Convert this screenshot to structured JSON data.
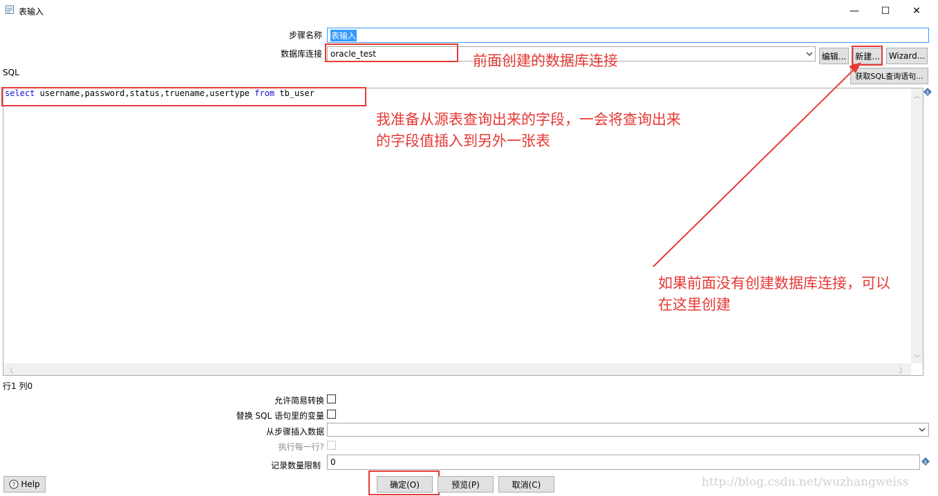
{
  "window": {
    "title": "表输入",
    "minimize_glyph": "—",
    "maximize_glyph": "☐",
    "close_glyph": "✕"
  },
  "form": {
    "step_name_label": "步骤名称",
    "step_name_value": "表输入",
    "db_conn_label": "数据库连接",
    "db_conn_value": "oracle_test",
    "edit_button": "编辑...",
    "new_button": "新建...",
    "wizard_button": "Wizard...",
    "sql_label": "SQL",
    "get_sql_button": "获取SQL查询语句..."
  },
  "sql": {
    "tokens": [
      {
        "text": "select",
        "kw": true
      },
      {
        "text": " username,password,status,truename,usertype ",
        "kw": false
      },
      {
        "text": "from",
        "kw": true
      },
      {
        "text": " tb_user",
        "kw": false
      }
    ],
    "status": "行1 列0"
  },
  "options": {
    "lazy_conversion_label": "允许简易转换",
    "replace_vars_label": "替换 SQL 语句里的变量",
    "insert_from_step_label": "从步骤插入数据",
    "execute_each_row_label": "执行每一行?",
    "limit_label": "记录数量限制",
    "limit_value": "0"
  },
  "footer": {
    "help_button": "Help",
    "ok_button": "确定(O)",
    "preview_button": "预览(P)",
    "cancel_button": "取消(C)",
    "watermark": "http://blog.csdn.net/wuzhangweiss"
  },
  "annotations": {
    "db_conn_note": "前面创建的数据库连接",
    "sql_note_line1": "我准备从源表查询出来的字段，一会将查询出来",
    "sql_note_line2": "的字段值插入到另外一张表",
    "new_note_line1": "如果前面没有创建数据库连接，可以",
    "new_note_line2": "在这里创建"
  },
  "colors": {
    "annotation_red": "#e53935",
    "sql_keyword": "#1010d0",
    "selection_blue": "#3399ff"
  }
}
